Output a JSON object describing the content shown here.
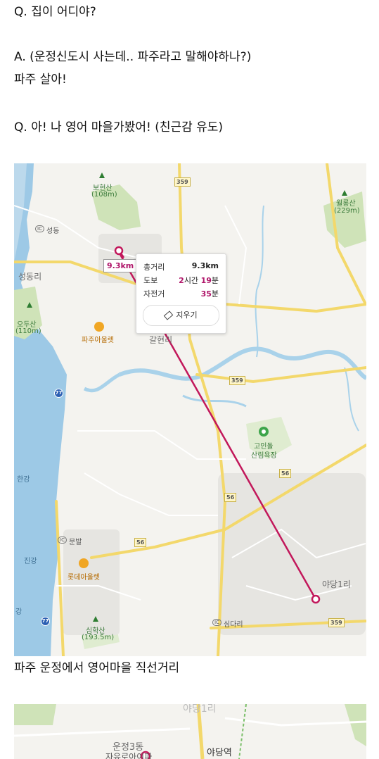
{
  "post": {
    "q1": "Q. 집이 어디야?",
    "a1": "A. (운정신도시 사는데.. 파주라고 말해야하나?)",
    "a1b": "파주 살아!",
    "q2": "Q. 아! 나 영어 마을가봤어! (친근감 유도)",
    "caption": "파주 운정에서 영어마을 직선거리"
  },
  "map": {
    "distance_tag": "9.3km",
    "popup": {
      "rows": [
        {
          "label": "총거리",
          "value": "9.3km"
        },
        {
          "label": "도보",
          "value_num1": "2",
          "value_unit1": "시간",
          "value_num2": "19",
          "value_unit2": "분"
        },
        {
          "label": "자전거",
          "value_num": "35",
          "value_unit": "분"
        }
      ],
      "erase_label": "지우기"
    },
    "places": {
      "bohyeonsan": "보현산",
      "bohyeonsan_h": "(108m)",
      "woolongsan": "월롱산",
      "woolongsan_h": "(229m)",
      "seongdong_ic": "성동",
      "seongdongri": "성동리",
      "odusan": "오두산",
      "odusan_h": "(110m)",
      "paju_outlet": "파주아울렛",
      "galhyeonri": "갈현리",
      "goindol": "고인돌",
      "sanrimyokjang": "산림욕장",
      "hangang": "한강",
      "munbal_ic": "문발",
      "jingang": "진강",
      "gang": "강",
      "lotte_outlet": "롯데아울렛",
      "simhaksan": "심학산",
      "simhaksan_h": "(193.5m)",
      "simdari_ic": "심다리",
      "yadang1ri": "야당1리",
      "ic": "IC"
    },
    "roads": {
      "r359": "359",
      "r56": "56",
      "r77": "77"
    },
    "colors": {
      "route": "#c2185b",
      "river": "#a9d2ea",
      "sea": "#9dc9e6",
      "land": "#f4f3ef",
      "forest": "#cfe3b8",
      "road_yellow": "#f3d86b"
    }
  },
  "map2": {
    "places": {
      "yadang1ri": "야당1리",
      "unjeong3dong": "운정3동",
      "yadang_station": "야당역",
      "apt": "자유로아이파"
    }
  }
}
